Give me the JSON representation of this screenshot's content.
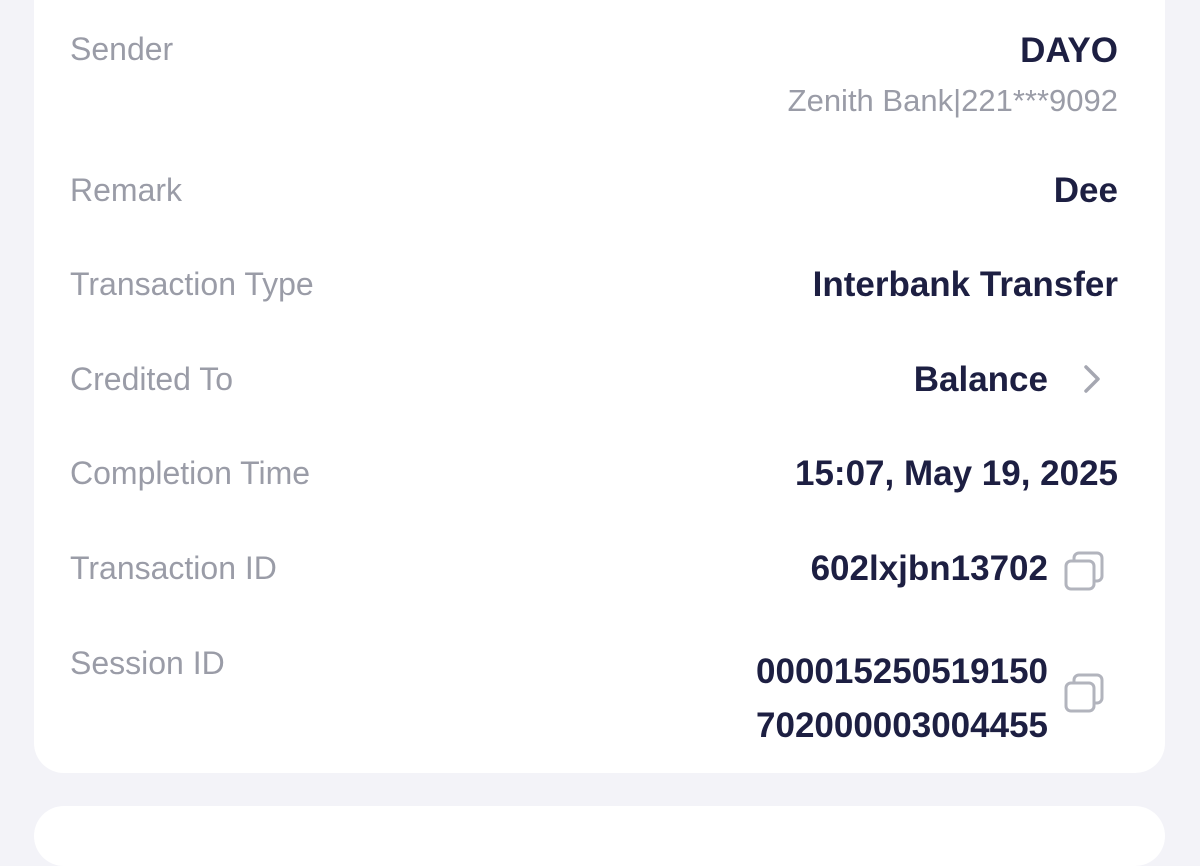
{
  "details": {
    "sender": {
      "label": "Sender",
      "name": "DAYO",
      "bank_account": "Zenith Bank|221***9092"
    },
    "remark": {
      "label": "Remark",
      "value": "Dee"
    },
    "transaction_type": {
      "label": "Transaction Type",
      "value": "Interbank Transfer"
    },
    "credited_to": {
      "label": "Credited To",
      "value": "Balance"
    },
    "completion_time": {
      "label": "Completion Time",
      "value": "15:07, May 19, 2025"
    },
    "transaction_id": {
      "label": "Transaction ID",
      "value": "602lxjbn13702"
    },
    "session_id": {
      "label": "Session ID",
      "line1": "000015250519150",
      "line2": "702000003004455"
    }
  },
  "icons": {
    "credited_to": "chevron-right-icon",
    "copy": "copy-icon"
  },
  "colors": {
    "background": "#f3f3f8",
    "card": "#ffffff",
    "label": "#9a9ca7",
    "value": "#1d1f42",
    "icon": "#a5a7b1"
  }
}
